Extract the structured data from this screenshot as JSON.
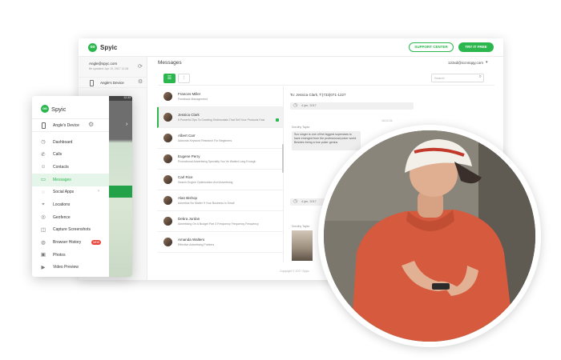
{
  "app": {
    "name": "Spyic",
    "logo_mark": "oo"
  },
  "topbar": {
    "support_label": "SUPPORT CENTER",
    "try_label": "TRY IT FREE",
    "user_email": "123xd@iccnnqqy.com"
  },
  "account": {
    "email": "Angle@spyc.com",
    "updated": "Be updated: Apr 10, 2017 11:28",
    "device_name": "Angle's Device"
  },
  "main": {
    "title": "Messages",
    "search_placeholder": "Search",
    "messages": [
      {
        "name": "Frances Miller",
        "preview": "Feedback Management"
      },
      {
        "name": "Jessica Clark",
        "preview": "5 Powerful Tips To Creating Testimonials That Sell Your Products Fast"
      },
      {
        "name": "Albert Carr",
        "preview": "Adwords Keyword Research For Beginners"
      },
      {
        "name": "Eugene Perry",
        "preview": "Promotional Advertising Specialty You Ve Waited Long Enough"
      },
      {
        "name": "Carl Rice",
        "preview": "Search Engine Optimization And Advertising"
      },
      {
        "name": "Alan Bishop",
        "preview": "Advertise No Matter If Your Business Is Small"
      },
      {
        "name": "Debra Jordan",
        "preview": "Advertising On A Budget Part 3 Frequency Frequency Frequency"
      },
      {
        "name": "Amanda Walters",
        "preview": "Effective Advertising Pointers"
      }
    ],
    "chat": {
      "to": "To: Jessica Clark, T:(733)071-1227",
      "date1": "4 jan, 2017",
      "time": "16:12:24",
      "sender": "Dorothy Taylor",
      "bubble": "Suv singer is one of the biggest superstars to have emerged from the professional poker world. Besides being a true poker genius",
      "date2": "4 jan, 2017",
      "sender2": "Dorothy Taylor"
    },
    "footer": "Copyright © 2017 Spyic"
  },
  "phone": {
    "status_time": "12:33",
    "device_name": "Angle's Device",
    "menu": [
      {
        "label": "Dashboard",
        "icon": "clock-icon"
      },
      {
        "label": "Calls",
        "icon": "phone-icon"
      },
      {
        "label": "Contacts",
        "icon": "person-icon"
      },
      {
        "label": "Messages",
        "icon": "chat-icon"
      },
      {
        "label": "Social Apps",
        "icon": "bubble-icon"
      },
      {
        "label": "Locations",
        "icon": "pin-icon"
      },
      {
        "label": "Geofence",
        "icon": "target-icon"
      },
      {
        "label": "Capture Screenshots",
        "icon": "camera-icon"
      },
      {
        "label": "Browser History",
        "icon": "globe-icon"
      },
      {
        "label": "Photos",
        "icon": "image-icon"
      },
      {
        "label": "Video Preview",
        "icon": "video-icon"
      }
    ],
    "new_badge": "NEW"
  },
  "colors": {
    "accent": "#2bb74e",
    "badge": "#e8453c"
  }
}
